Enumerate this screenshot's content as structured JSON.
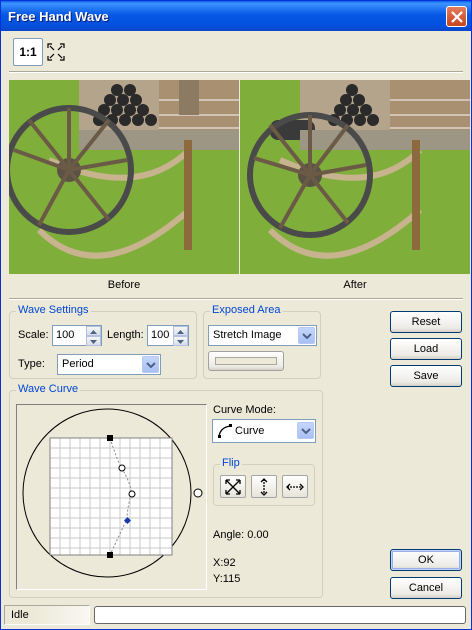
{
  "window": {
    "title": "Free Hand Wave"
  },
  "toolbar": {
    "actual_size_label": "1:1",
    "fit_icon": "fit-to-window-icon"
  },
  "preview": {
    "before_label": "Before",
    "after_label": "After"
  },
  "wave_settings": {
    "title": "Wave Settings",
    "scale_label": "Scale:",
    "scale_value": "100",
    "length_label": "Length:",
    "length_value": "100",
    "type_label": "Type:",
    "type_value": "Period"
  },
  "exposed_area": {
    "title": "Exposed Area",
    "mode_value": "Stretch Image"
  },
  "buttons": {
    "reset": "Reset",
    "load": "Load",
    "save": "Save",
    "ok": "OK",
    "cancel": "Cancel"
  },
  "wave_curve": {
    "title": "Wave Curve",
    "curve_mode_label": "Curve Mode:",
    "curve_mode_value": "Curve",
    "flip_title": "Flip",
    "angle_text": "Angle: 0.00",
    "x_text": "X:92",
    "y_text": "Y:115"
  },
  "status": {
    "text": "Idle",
    "progress": 0
  },
  "colors": {
    "title_bar": "#0758E5",
    "group_title": "#0046D5",
    "face": "#ECE9D8"
  }
}
